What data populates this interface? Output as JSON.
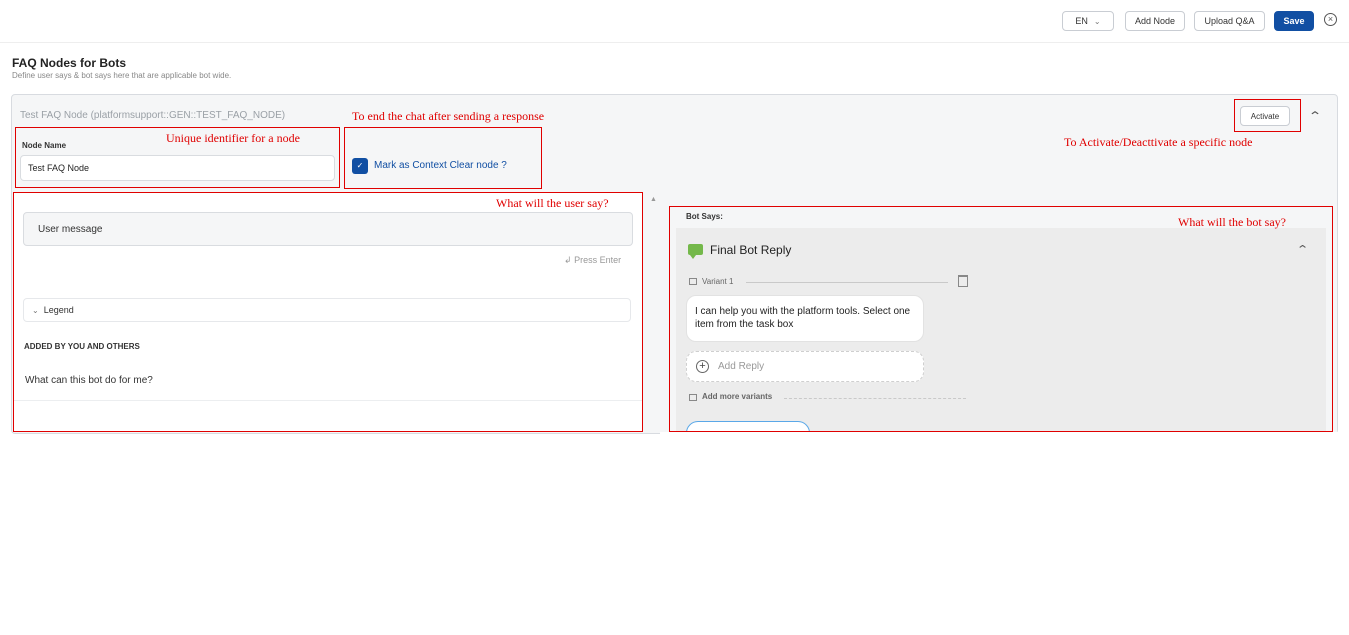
{
  "topbar": {
    "language": "EN",
    "add_node_label": "Add Node",
    "upload_label": "Upload Q&A",
    "save_label": "Save"
  },
  "page": {
    "title": "FAQ Nodes for Bots",
    "subtitle": "Define user says & bot says here that are applicable bot wide."
  },
  "node": {
    "header": "Test FAQ Node (platformsupport::GEN::TEST_FAQ_NODE)",
    "activate_label": "Activate",
    "name_label": "Node Name",
    "name_value": "Test FAQ Node",
    "context_clear_label": "Mark as Context Clear node ?"
  },
  "user_says": {
    "input_placeholder": "User message",
    "press_enter": "Press Enter",
    "legend_label": "Legend",
    "section_header": "ADDED BY YOU AND OTHERS",
    "items": [
      "What can this bot do for me?"
    ]
  },
  "bot_says": {
    "header": "Bot Says:",
    "reply_title": "Final Bot Reply",
    "variant_label": "Variant 1",
    "message": "I can help you with the platform tools. Select one item from the task box",
    "add_reply": "Add Reply",
    "add_variants": "Add more variants"
  },
  "annotations": {
    "node_identifier": "Unique identifier for a node",
    "end_chat": "To end the chat after sending a response",
    "activate": "To Activate/Deacttivate a specific node",
    "user_say": "What will the user say?",
    "bot_say": "What will the bot say?"
  },
  "colors": {
    "primary": "#114fa3",
    "annotation": "#e00000",
    "bot_icon": "#74b84a"
  }
}
